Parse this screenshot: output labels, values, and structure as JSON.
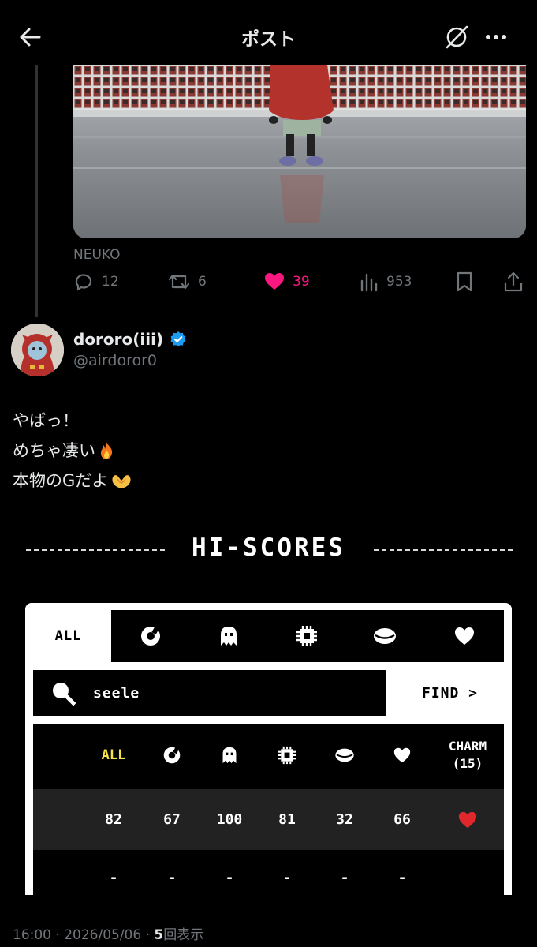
{
  "header": {
    "title": "ポスト"
  },
  "media_source": "NEUKO",
  "actions": {
    "replies": "12",
    "reposts": "6",
    "likes": "39",
    "views": "953"
  },
  "author": {
    "name": "dororo(iii)",
    "handle": "@airdoror0"
  },
  "tweet": {
    "line1": "やばっ！",
    "line2": "めちゃ凄い",
    "line3": "本物のGだよ"
  },
  "hiscores": {
    "title": "HI-SCORES",
    "tab_all": "ALL",
    "tabs": [
      "loop-icon",
      "ghost-icon",
      "chip-icon",
      "coin-icon",
      "heart-icon"
    ],
    "search_value": "seele",
    "find_label": "FIND >",
    "columns": {
      "all": "ALL",
      "charm_line1": "CHARM",
      "charm_line2": "(15)"
    },
    "row1": [
      "82",
      "67",
      "100",
      "81",
      "32",
      "66"
    ],
    "row2": [
      "-",
      "-",
      "-",
      "-",
      "-",
      "-"
    ]
  },
  "footer": {
    "time": "16:00 · 2026/05/06 · ",
    "views": "5",
    "views_label": "回表示"
  },
  "colors": {
    "like": "#f91880",
    "verified": "#1d9bf0",
    "all_highlight": "#f3e24a",
    "charm_heart": "#e0282c"
  }
}
